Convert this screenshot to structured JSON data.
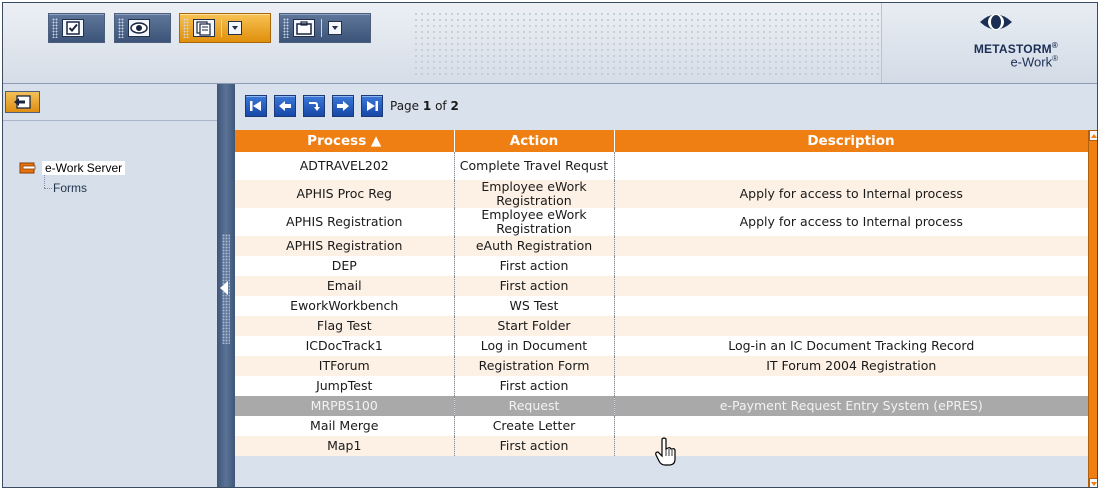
{
  "toolbar": {
    "buttons": [
      {
        "name": "checkbox-icon"
      },
      {
        "name": "eye-icon"
      },
      {
        "name": "forms-list-icon",
        "active": true
      },
      {
        "name": "briefcase-icon"
      }
    ]
  },
  "branding": {
    "company": "METASTORM",
    "company_mark": "®",
    "product": "e-Work",
    "product_mark": "®",
    "colors": {
      "dark": "#1b2f55",
      "accent": "#ef7f12"
    }
  },
  "tree": {
    "root": "e-Work Server",
    "child": "Forms"
  },
  "pager": {
    "prefix": "Page",
    "current": "1",
    "of": "of",
    "total": "2"
  },
  "table": {
    "headers": {
      "process": "Process ▲",
      "action": "Action",
      "description": "Description"
    },
    "rows": [
      {
        "process": "ADTRAVEL202",
        "action": "Complete Travel Requst",
        "description": ""
      },
      {
        "process": "APHIS Proc Reg",
        "action": "Employee eWork Registration",
        "description": "Apply for access to Internal process"
      },
      {
        "process": "APHIS Registration",
        "action": "Employee eWork Registration",
        "description": "Apply for access to Internal process"
      },
      {
        "process": "APHIS Registration",
        "action": "eAuth Registration",
        "description": ""
      },
      {
        "process": "DEP",
        "action": "First action",
        "description": ""
      },
      {
        "process": "Email",
        "action": "First action",
        "description": ""
      },
      {
        "process": "EworkWorkbench",
        "action": "WS Test",
        "description": ""
      },
      {
        "process": "Flag Test",
        "action": "Start Folder",
        "description": ""
      },
      {
        "process": "ICDocTrack1",
        "action": "Log in Document",
        "description": "Log-in an IC Document Tracking Record"
      },
      {
        "process": "ITForum",
        "action": "Registration Form",
        "description": "IT Forum 2004 Registration"
      },
      {
        "process": "JumpTest",
        "action": "First action",
        "description": ""
      },
      {
        "process": "MRPBS100",
        "action": "Request",
        "description": "e-Payment Request Entry System (ePRES)",
        "selected": true
      },
      {
        "process": "Mail Merge",
        "action": "Create Letter",
        "description": ""
      },
      {
        "process": "Map1",
        "action": "First action",
        "description": ""
      }
    ]
  }
}
